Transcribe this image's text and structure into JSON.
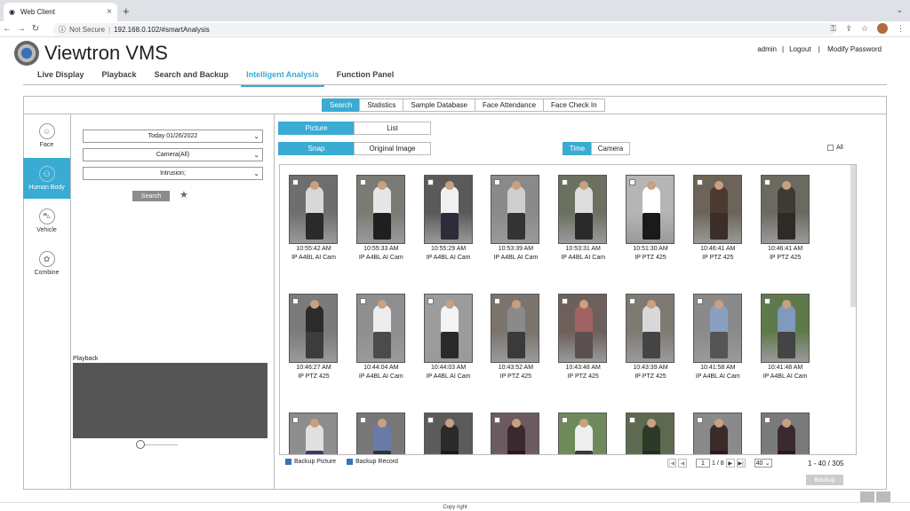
{
  "browser": {
    "tab_title": "Web Client",
    "security": "Not Secure",
    "url": "192.168.0.102/#smartAnalysis"
  },
  "app": {
    "name": "Viewtron VMS",
    "account": {
      "user": "admin",
      "logout": "Logout",
      "modify_password": "Modify Password"
    },
    "nav": [
      "Live Display",
      "Playback",
      "Search and Backup",
      "Intelligent Analysis",
      "Function Panel"
    ],
    "nav_active": "Intelligent Analysis",
    "subtabs": [
      "Search",
      "Statistics",
      "Sample Database",
      "Face Attendance",
      "Face Check In"
    ],
    "subtab_active": "Search"
  },
  "categories": [
    {
      "label": "Face",
      "icon": "face-icon"
    },
    {
      "label": "Human Body",
      "icon": "human-body-icon",
      "active": true
    },
    {
      "label": "Vehicle",
      "icon": "vehicle-icon"
    },
    {
      "label": "Combine",
      "icon": "combine-icon"
    }
  ],
  "filters": {
    "date": "Today 01/26/2022",
    "camera": "Camera(All)",
    "event": "Intrusion;",
    "search_label": "Search",
    "playback_label": "Playback"
  },
  "view": {
    "mode_options": [
      "Picture",
      "List"
    ],
    "mode_active": "Picture",
    "image_options": [
      "Snap",
      "Original Image"
    ],
    "image_active": "Snap",
    "sort_options": [
      "Time",
      "Camera"
    ],
    "sort_active": "Time",
    "all_label": "All"
  },
  "results": [
    {
      "time": "10:55:42 AM",
      "camera": "IP A4BL AI Cam"
    },
    {
      "time": "10:55:33 AM",
      "camera": "IP A4BL AI Cam"
    },
    {
      "time": "10:55:29 AM",
      "camera": "IP A4BL AI Cam"
    },
    {
      "time": "10:53:39 AM",
      "camera": "IP A4BL AI Cam"
    },
    {
      "time": "10:53:31 AM",
      "camera": "IP A4BL AI Cam"
    },
    {
      "time": "10:51:30 AM",
      "camera": "IP PTZ 425"
    },
    {
      "time": "10:46:41 AM",
      "camera": "IP PTZ 425"
    },
    {
      "time": "10:46:41 AM",
      "camera": "IP PTZ 425"
    },
    {
      "time": "10:46:27 AM",
      "camera": "IP PTZ 425"
    },
    {
      "time": "10:44:04 AM",
      "camera": "IP A4BL AI Cam"
    },
    {
      "time": "10:44:03 AM",
      "camera": "IP A4BL AI Cam"
    },
    {
      "time": "10:43:52 AM",
      "camera": "IP PTZ 425"
    },
    {
      "time": "10:43:48 AM",
      "camera": "IP PTZ 425"
    },
    {
      "time": "10:43:39 AM",
      "camera": "IP PTZ 425"
    },
    {
      "time": "10:41:58 AM",
      "camera": "IP A4BL AI Cam"
    },
    {
      "time": "10:41:48 AM",
      "camera": "IP A4BL AI Cam"
    },
    {
      "time": "",
      "camera": ""
    },
    {
      "time": "",
      "camera": ""
    },
    {
      "time": "",
      "camera": ""
    },
    {
      "time": "",
      "camera": ""
    },
    {
      "time": "",
      "camera": ""
    },
    {
      "time": "",
      "camera": ""
    },
    {
      "time": "",
      "camera": ""
    },
    {
      "time": "",
      "camera": ""
    }
  ],
  "footer": {
    "backup_picture": "Backup Picture",
    "backup_record": "Backup Record",
    "page_current": "1",
    "page_total": "1 / 8",
    "page_size": "40",
    "range": "1 - 40 / 305",
    "backup_label": "Backup",
    "copyright": "Copy right"
  },
  "colors": {
    "accent": "#3aabd2",
    "playback_bg": "#555555"
  }
}
